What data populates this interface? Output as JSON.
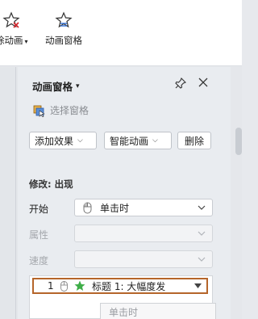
{
  "ribbon": {
    "remove_animation_label": "除动画",
    "animation_pane_label": "动画窗格"
  },
  "pane": {
    "title": "动画窗格",
    "select_pane_label": "选择窗格",
    "buttons": {
      "add_effect": "添加效果",
      "smart_animation": "智能动画",
      "delete": "删除"
    },
    "modify_label": "修改: 出现",
    "start": {
      "label": "开始",
      "value": "单击时"
    },
    "property": {
      "label": "属性",
      "value": ""
    },
    "speed": {
      "label": "速度",
      "value": ""
    },
    "animation_list": [
      {
        "index": "1",
        "name": "标题 1: 大幅度发"
      }
    ],
    "tooltip": "单击时"
  },
  "colors": {
    "selected_border": "#b5652a",
    "star_green": "#3fae49"
  }
}
